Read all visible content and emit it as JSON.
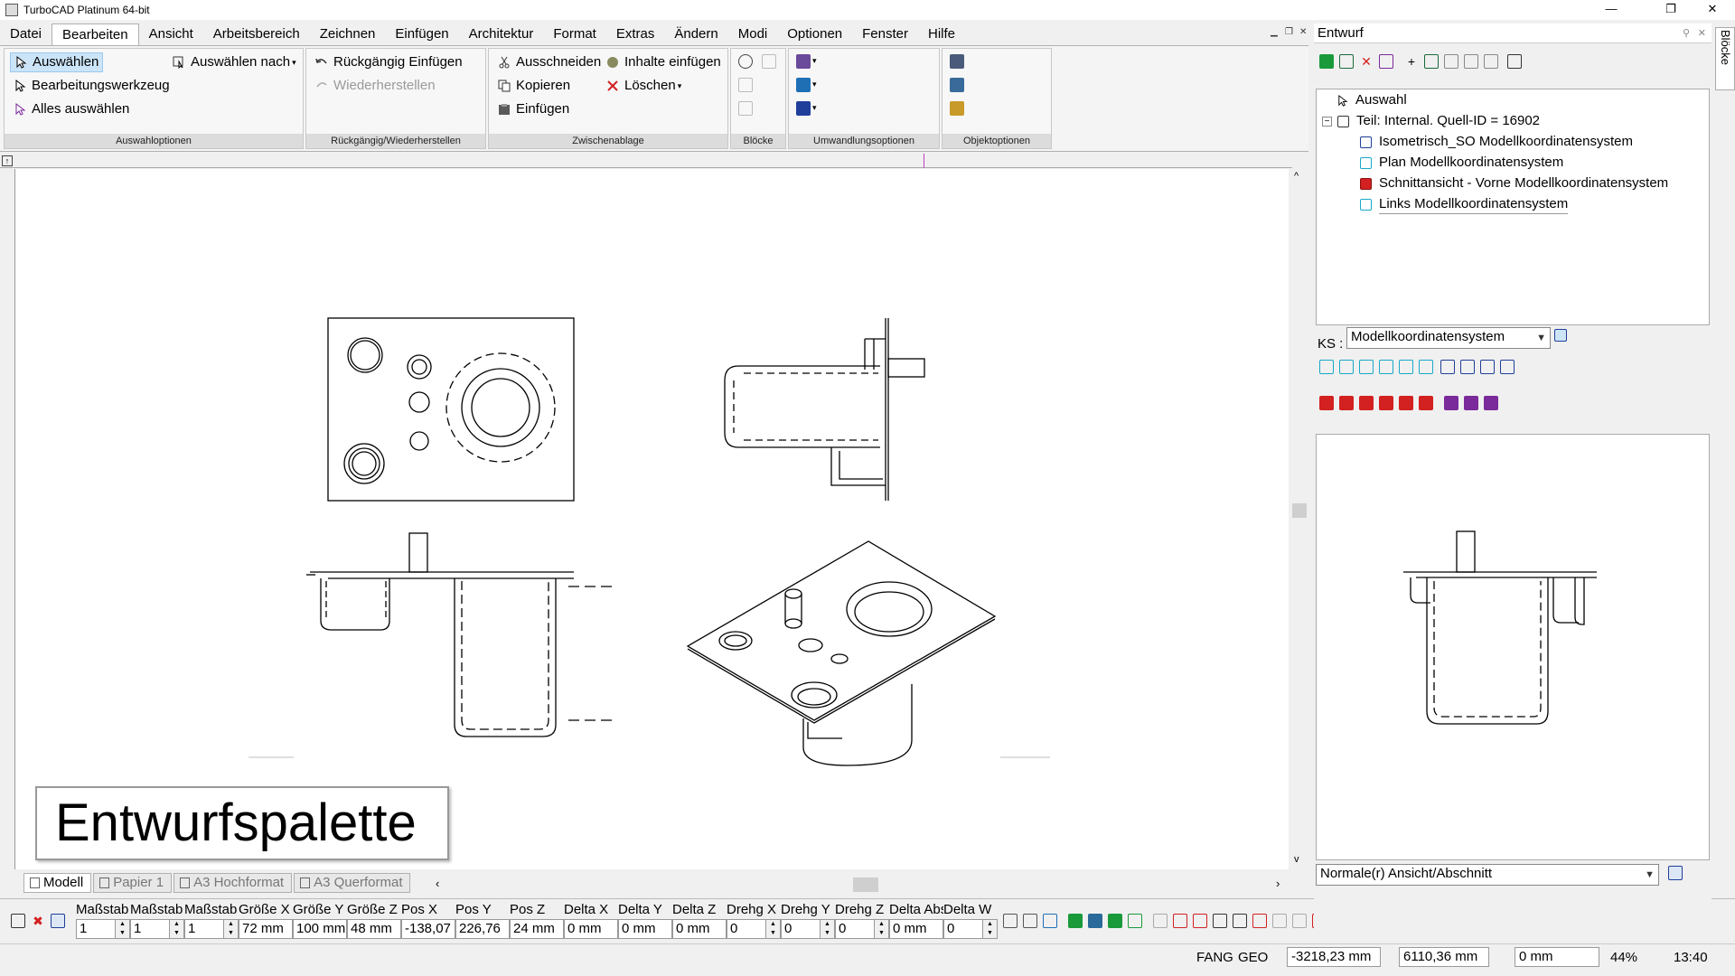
{
  "window": {
    "title": "TurboCAD  Platinum 64-bit",
    "min": "—",
    "restore": "❐",
    "close": "✕"
  },
  "menu": [
    "Datei",
    "Bearbeiten",
    "Ansicht",
    "Arbeitsbereich",
    "Zeichnen",
    "Einfügen",
    "Architektur",
    "Format",
    "Extras",
    "Ändern",
    "Modi",
    "Optionen",
    "Fenster",
    "Hilfe"
  ],
  "menu_active": "Bearbeiten",
  "ribbon": {
    "select_group": {
      "label": "Auswahloptionen",
      "select": "Auswählen",
      "select_by": "Auswählen nach",
      "edit_tool": "Bearbeitungswerkzeug",
      "select_all": "Alles auswählen"
    },
    "undo_group": {
      "label": "Rückgängig/Wiederherstellen",
      "undo": "Rückgängig Einfügen",
      "redo": "Wiederherstellen"
    },
    "clipboard_group": {
      "label": "Zwischenablage",
      "cut": "Ausschneiden",
      "copy": "Kopieren",
      "paste": "Einfügen",
      "paste_special": "Inhalte einfügen",
      "delete": "Löschen"
    },
    "blocks_group": {
      "label": "Blöcke"
    },
    "transform_group": {
      "label": "Umwandlungsoptionen"
    },
    "object_group": {
      "label": "Objektoptionen"
    }
  },
  "canvas": {
    "palette_label": "Entwurfspalette"
  },
  "sheet_tabs": [
    "Modell",
    "Papier 1",
    "A3 Hochformat",
    "A3 Querformat"
  ],
  "inspector": {
    "fields": [
      {
        "label": "Maßstab",
        "value": "1"
      },
      {
        "label": "Maßstab",
        "value": "1"
      },
      {
        "label": "Maßstab",
        "value": "1"
      },
      {
        "label": "Größe X",
        "value": "72 mm"
      },
      {
        "label": "Größe Y",
        "value": "100 mm"
      },
      {
        "label": "Größe Z",
        "value": "48 mm"
      },
      {
        "label": "Pos X",
        "value": "-138,07"
      },
      {
        "label": "Pos Y",
        "value": "226,76"
      },
      {
        "label": "Pos Z",
        "value": "24 mm"
      },
      {
        "label": "Delta X",
        "value": "0 mm"
      },
      {
        "label": "Delta Y",
        "value": "0 mm"
      },
      {
        "label": "Delta Z",
        "value": "0 mm"
      },
      {
        "label": "Drehg X",
        "value": "0"
      },
      {
        "label": "Drehg Y",
        "value": "0"
      },
      {
        "label": "Drehg Z",
        "value": "0"
      },
      {
        "label": "Delta Abst.",
        "value": "0 mm"
      },
      {
        "label": "Delta W",
        "value": "0"
      }
    ]
  },
  "status": {
    "snap": "FANG",
    "geo": "GEO",
    "coord_x": "-3218,23 mm",
    "coord_y": "6110,36 mm",
    "coord_z": "0 mm",
    "zoom": "44%",
    "time": "13:40"
  },
  "panel": {
    "title": "Entwurf",
    "side_tab": "Blöcke",
    "tree": [
      {
        "label": "Auswahl"
      },
      {
        "label": "Teil: Internal. Quell-ID = 16902"
      },
      {
        "label": "Isometrisch_SO Modellkoordinatensystem"
      },
      {
        "label": "Plan Modellkoordinatensystem"
      },
      {
        "label": "Schnittansicht - Vorne Modellkoordinatensystem"
      },
      {
        "label": "Links Modellkoordinatensystem"
      }
    ],
    "ks_label": "KS :",
    "ks_value": "Modellkoordinatensystem",
    "view_select": "Normale(r) Ansicht/Abschnitt"
  },
  "colors": {
    "accent": "#cce4f7",
    "icon_blue": "#1f6fb5",
    "icon_red": "#d32020",
    "icon_cyan": "#18a8c8",
    "icon_purple": "#7a2a9a"
  }
}
